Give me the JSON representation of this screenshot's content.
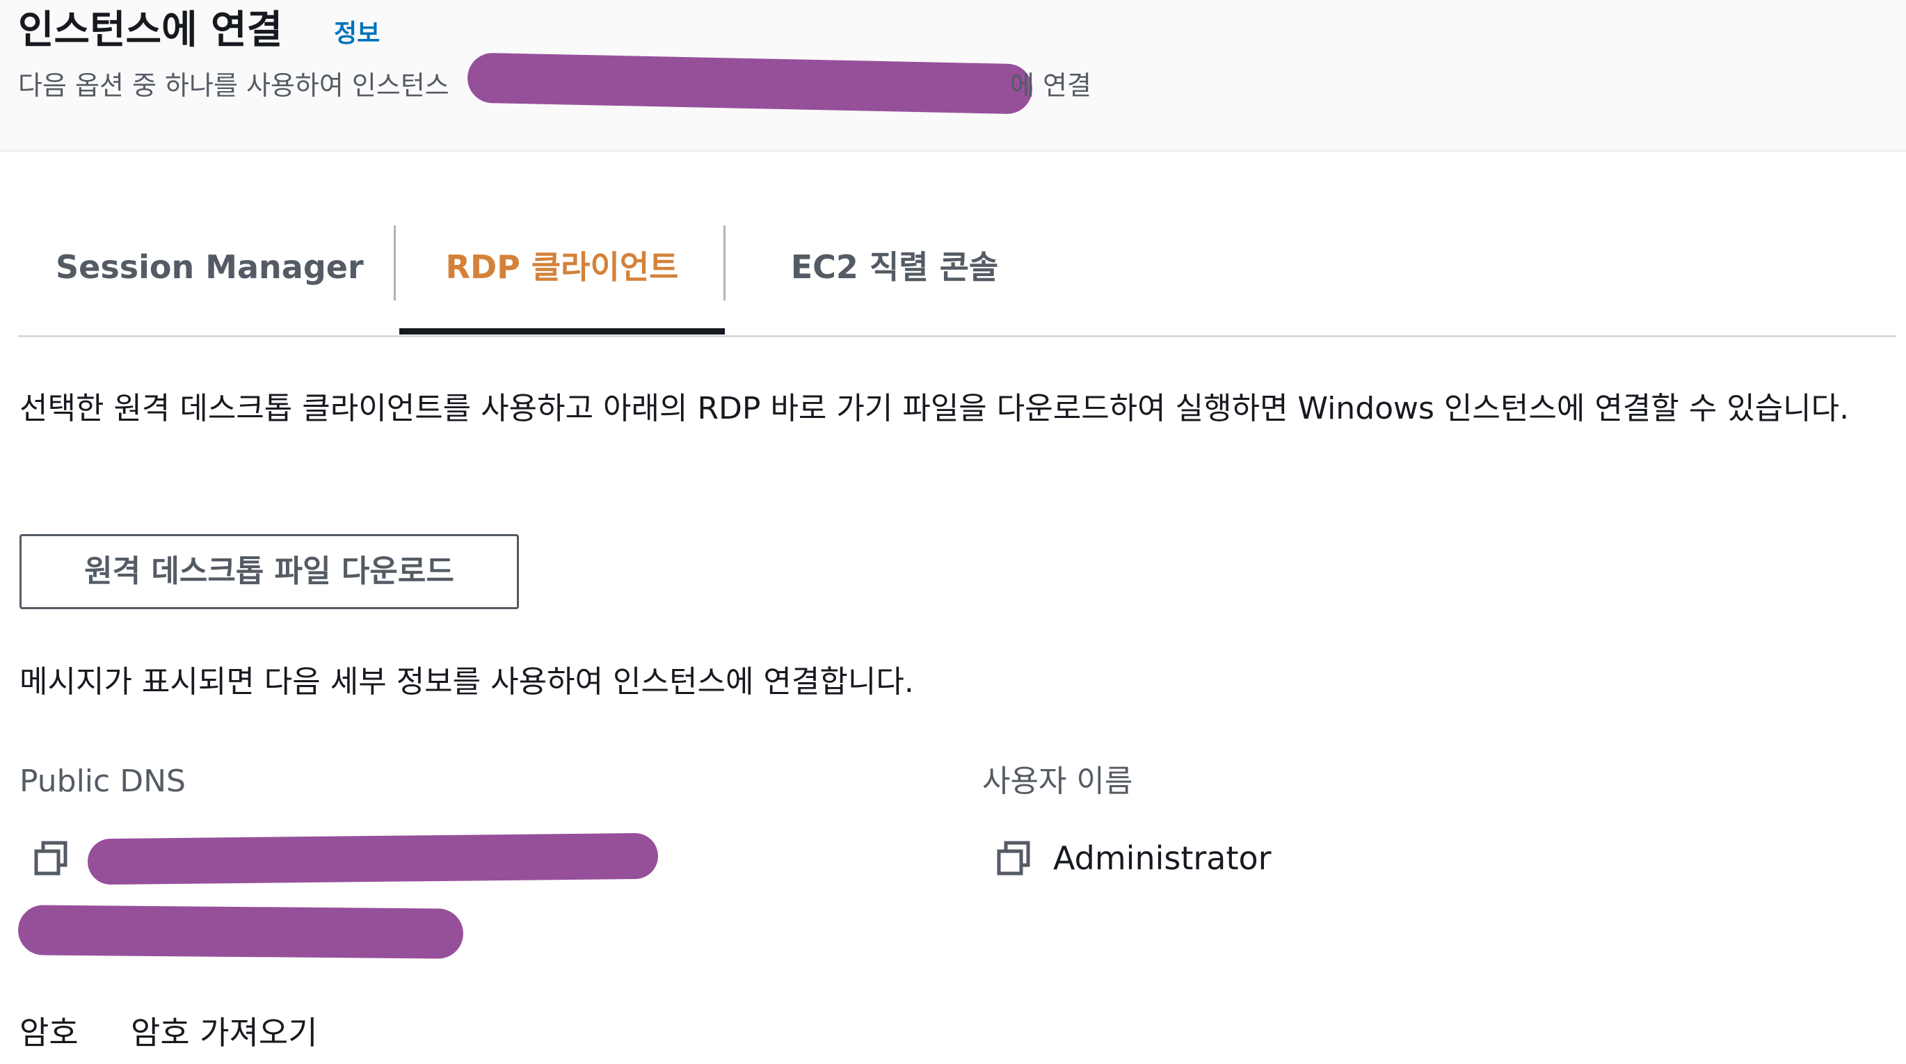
{
  "header": {
    "title": "인스턴스에 연결",
    "info_link": "정보",
    "subtitle_prefix": "다음 옵션 중 하나를 사용하여 인스턴스",
    "subtitle_suffix": "에 연결"
  },
  "tabs": [
    {
      "label": "Session Manager",
      "active": false
    },
    {
      "label": "RDP 클라이언트",
      "active": true
    },
    {
      "label": "EC2 직렬 콘솔",
      "active": false
    }
  ],
  "rdp": {
    "description": "선택한 원격 데스크톱 클라이언트를 사용하고 아래의 RDP 바로 가기 파일을 다운로드하여 실행하면 Windows 인스턴스에 연결할 수 있습니다.",
    "download_button": "원격 데스크톱 파일 다운로드",
    "message": "메시지가 표시되면 다음 세부 정보를 사용하여 인스턴스에 연결합니다.",
    "public_dns_label": "Public DNS",
    "username_label": "사용자 이름",
    "username_value": "Administrator",
    "password_label": "암호",
    "password_link": "암호 가져오기"
  },
  "colors": {
    "active_tab": "#d4813a",
    "info_link": "#0073bb",
    "redaction": "#96509a"
  }
}
